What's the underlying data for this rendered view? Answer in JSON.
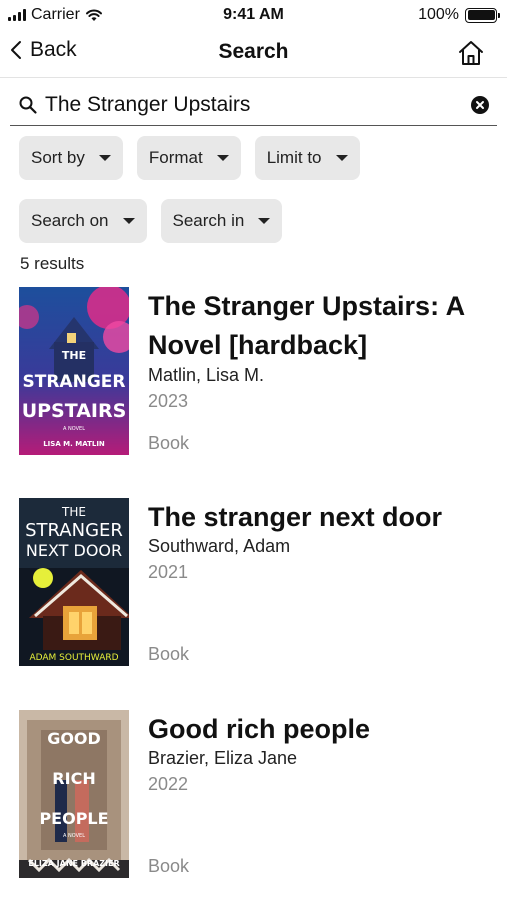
{
  "status_bar": {
    "carrier": "Carrier",
    "time": "9:41 AM",
    "battery": "100%"
  },
  "nav": {
    "back_label": "Back",
    "title": "Search"
  },
  "search": {
    "value": "The Stranger Upstairs"
  },
  "filters": {
    "sort_by": "Sort by",
    "format": "Format",
    "limit_to": "Limit to",
    "search_on": "Search on",
    "search_in": "Search in"
  },
  "results_count": "5 results",
  "results": [
    {
      "title": "The Stranger Upstairs: A Novel [hardback]",
      "author": "Matlin, Lisa M.",
      "year": "2023",
      "format": "Book",
      "cover": {
        "line1": "THE",
        "line2": "STRANGER",
        "line3": "UPSTAIRS",
        "tag": "A NOVEL",
        "author": "LISA M. MATLIN"
      }
    },
    {
      "title": "The stranger next door",
      "author": "Southward, Adam",
      "year": "2021",
      "format": "Book",
      "cover": {
        "line1": "THE",
        "line2": "STRANGER",
        "line3": "NEXT DOOR",
        "author": "ADAM SOUTHWARD"
      }
    },
    {
      "title": "Good rich people",
      "author": "Brazier, Eliza Jane",
      "year": "2022",
      "format": "Book",
      "cover": {
        "line1": "GOOD",
        "line2": "RICH",
        "line3": "PEOPLE",
        "tag": "A NOVEL",
        "author": "ELIZA JANE BRAZIER"
      }
    }
  ]
}
